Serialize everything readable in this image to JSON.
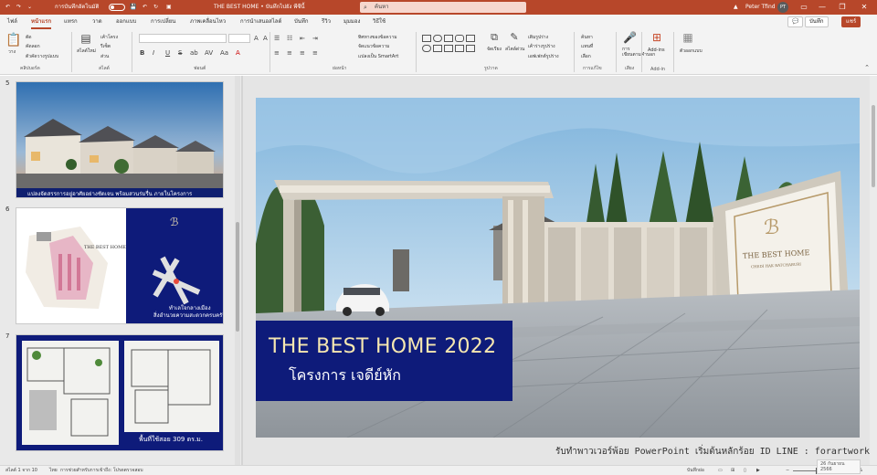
{
  "titlebar": {
    "autosave_label": "การบันทึกอัตโนมัติ",
    "doc_title": "THE BEST HOME • บันทึกไปยัง พีซีนี้",
    "search_placeholder": "ค้นหา",
    "user_name": "Peter Tfind",
    "user_initials": "PT",
    "minimize": "—",
    "restore": "❐",
    "close": "✕"
  },
  "tabs": [
    "ไฟล์",
    "หน้าแรก",
    "แทรก",
    "วาด",
    "ออกแบบ",
    "การเปลี่ยน",
    "ภาพเคลื่อนไหว",
    "การนำเสนอสไลด์",
    "บันทึก",
    "รีวิว",
    "มุมมอง",
    "วิธีใช้"
  ],
  "active_tab": "หน้าแรก",
  "header_buttons": {
    "comment": "💬",
    "record": "บันทึก",
    "share": "แชร์"
  },
  "ribbon": {
    "groups": {
      "clipboard": "คลิปบอร์ด",
      "slides": "สไลด์",
      "font": "ฟอนต์",
      "paragraph": "ย่อหน้า",
      "drawing": "รูปวาด",
      "editing": "การแก้ไข",
      "voice": "เสียง",
      "addins": "Add-in"
    },
    "clipboard": {
      "paste": "วาง",
      "cut": "ตัด",
      "copy": "คัดลอก",
      "format_painter": "ตัวคัดวางรูปแบบ"
    },
    "slides": {
      "new_slide": "สไลด์ใหม่",
      "layout": "เค้าโครง",
      "reset": "รีเซ็ต",
      "section": "ส่วน"
    },
    "font_buttons": [
      "B",
      "I",
      "U",
      "S",
      "ab",
      "AV",
      "Aa",
      "A"
    ],
    "paragraph": {
      "text_direction": "ทิศทางของข้อความ",
      "align_text": "จัดแนวข้อความ",
      "smartart": "แปลงเป็น SmartArt"
    },
    "drawing": {
      "arrange": "จัดเรียง",
      "quick_styles": "สไตล์ด่วน",
      "shape_fill": "เติมรูปร่าง",
      "shape_outline": "เค้าร่างรูปร่าง",
      "shape_effects": "เอฟเฟกต์รูปร่าง"
    },
    "editing": {
      "find": "ค้นหา",
      "replace": "แทนที่",
      "select": "เลือก"
    },
    "voice": {
      "dictate": "การ\nเขียนตามคำบอก"
    },
    "addins": {
      "addins": "Add-ins",
      "designer": "ตัวออกแบบ"
    }
  },
  "slides_panel": {
    "slides": [
      {
        "number": "5",
        "caption": "แปลงจัดสรรการอยู่อาศัยอย่างชัดเจน พร้อมสวนร่มรื่น ภายในโครงการ"
      },
      {
        "number": "6",
        "brand": "THE BEST HOME",
        "caption": "ทำเลใจกลางเมือง\nสิ่งอำนวยความสะดวกครบครัน"
      },
      {
        "number": "7",
        "caption": "พื้นที่ใช้สอย 309 ตร.ม."
      }
    ]
  },
  "slide": {
    "title": "THE BEST HOME 2022",
    "subtitle": "โครงการ เจดีย์หัก",
    "sign_brand": "THE BEST HOME",
    "sign_sub": "CHEDI HAK RATCHABURI"
  },
  "promo_text": "รับทำพาวเวอร์พ้อย PowerPoint เริ่มต้นหลักร้อย ID LINE : forartwork",
  "statusbar": {
    "slide_count": "สไลด์ 1 จาก 10",
    "language": "ไทย",
    "accessibility": "การช่วยสำหรับการเข้าถึง: โปรดตรวจสอบ",
    "notes": "บันทึกย่อ",
    "zoom": "124%"
  },
  "clock": {
    "time": "26 กันยายน 2566",
    "date": "..."
  },
  "colors": {
    "brand": "#b7472a",
    "slide_title_bg": "#0e1b7a",
    "slide_title_fg": "#f6e7b0"
  }
}
